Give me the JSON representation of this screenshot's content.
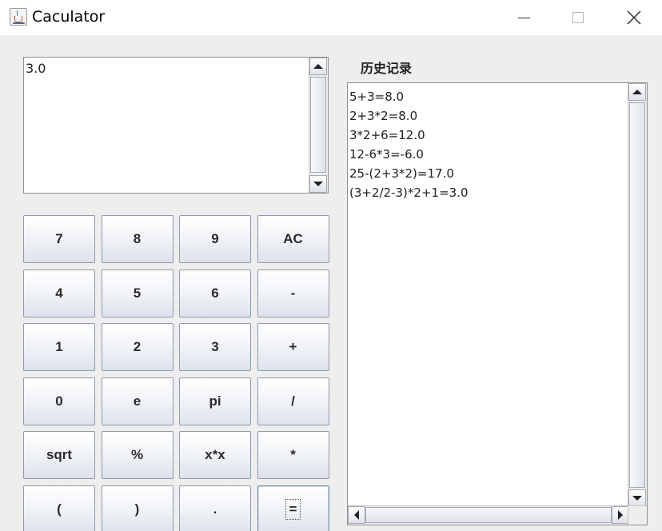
{
  "window": {
    "title": "Caculator",
    "icon": "java-coffee-cup-icon",
    "controls": [
      "minimize-icon",
      "maximize-icon",
      "close-icon"
    ]
  },
  "display": {
    "value": "3.0"
  },
  "keypad": {
    "rows": [
      [
        "7",
        "8",
        "9",
        "AC"
      ],
      [
        "4",
        "5",
        "6",
        "-"
      ],
      [
        "1",
        "2",
        "3",
        "+"
      ],
      [
        "0",
        "e",
        "pi",
        "/"
      ],
      [
        "sqrt",
        "%",
        "x*x",
        "*"
      ],
      [
        "(",
        ")",
        ".",
        "="
      ]
    ],
    "focused_key": "="
  },
  "history": {
    "title": "历史记录",
    "entries": [
      "5+3=8.0",
      "2+3*2=8.0",
      "3*2+6=12.0",
      "12-6*3=-6.0",
      "25-(2+3*2)=17.0",
      "(3+2/2-3)*2+1=3.0"
    ]
  },
  "colors": {
    "window_bg": "#eeeeee",
    "titlebar_bg": "#ffffff",
    "button_border": "#8e9aab"
  }
}
